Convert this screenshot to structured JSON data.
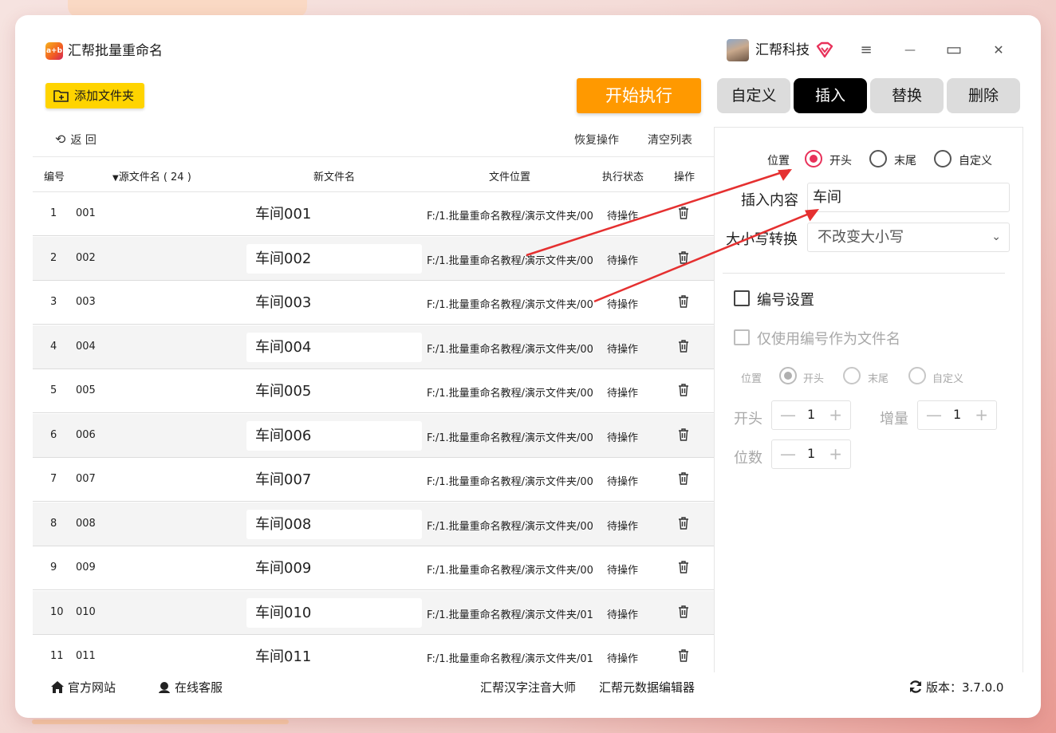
{
  "app": {
    "title": "汇帮批量重命名",
    "logo_text": "a+b"
  },
  "user": {
    "name": "汇帮科技"
  },
  "window_controls": {
    "menu": "≡",
    "minimize": "—",
    "maximize": "▭",
    "close": "✕"
  },
  "toolbar": {
    "add_folder": "添加文件夹",
    "start": "开始执行",
    "tabs": [
      {
        "label": "自定义",
        "active": false
      },
      {
        "label": "插入",
        "active": true
      },
      {
        "label": "替换",
        "active": false
      },
      {
        "label": "删除",
        "active": false
      }
    ]
  },
  "list_actions": {
    "back": "返 回",
    "restore": "恢复操作",
    "clear": "清空列表"
  },
  "table": {
    "headers": {
      "index": "编号",
      "source": "源文件名 ( 24 )",
      "new_name": "新文件名",
      "location": "文件位置",
      "status": "执行状态",
      "action": "操作"
    },
    "rows": [
      {
        "idx": "1",
        "src": "001",
        "new": "车间001",
        "path": "F:/1.批量重命名教程/演示文件夹/00",
        "status": "待操作"
      },
      {
        "idx": "2",
        "src": "002",
        "new": "车间002",
        "path": "F:/1.批量重命名教程/演示文件夹/00",
        "status": "待操作"
      },
      {
        "idx": "3",
        "src": "003",
        "new": "车间003",
        "path": "F:/1.批量重命名教程/演示文件夹/00",
        "status": "待操作"
      },
      {
        "idx": "4",
        "src": "004",
        "new": "车间004",
        "path": "F:/1.批量重命名教程/演示文件夹/00",
        "status": "待操作"
      },
      {
        "idx": "5",
        "src": "005",
        "new": "车间005",
        "path": "F:/1.批量重命名教程/演示文件夹/00",
        "status": "待操作"
      },
      {
        "idx": "6",
        "src": "006",
        "new": "车间006",
        "path": "F:/1.批量重命名教程/演示文件夹/00",
        "status": "待操作"
      },
      {
        "idx": "7",
        "src": "007",
        "new": "车间007",
        "path": "F:/1.批量重命名教程/演示文件夹/00",
        "status": "待操作"
      },
      {
        "idx": "8",
        "src": "008",
        "new": "车间008",
        "path": "F:/1.批量重命名教程/演示文件夹/00",
        "status": "待操作"
      },
      {
        "idx": "9",
        "src": "009",
        "new": "车间009",
        "path": "F:/1.批量重命名教程/演示文件夹/00",
        "status": "待操作"
      },
      {
        "idx": "10",
        "src": "010",
        "new": "车间010",
        "path": "F:/1.批量重命名教程/演示文件夹/01",
        "status": "待操作"
      },
      {
        "idx": "11",
        "src": "011",
        "new": "车间011",
        "path": "F:/1.批量重命名教程/演示文件夹/01",
        "status": "待操作"
      }
    ]
  },
  "panel": {
    "position_label": "位置",
    "position_options": [
      "开头",
      "末尾",
      "自定义"
    ],
    "position_selected": "开头",
    "insert_label": "插入内容",
    "insert_value": "车间",
    "case_label": "大小写转换",
    "case_value": "不改变大小写",
    "numbering_label": "编号设置",
    "numbering_only_label": "仅使用编号作为文件名",
    "num_position_label": "位置",
    "num_position_options": [
      "开头",
      "末尾",
      "自定义"
    ],
    "start_label": "开头",
    "start_value": "1",
    "increment_label": "增量",
    "increment_value": "1",
    "digits_label": "位数",
    "digits_value": "1",
    "minus": "—",
    "plus": "+"
  },
  "footer": {
    "website": "官方网站",
    "support": "在线客服",
    "link1": "汇帮汉字注音大师",
    "link2": "汇帮元数据编辑器",
    "version": "版本：3.7.0.0"
  },
  "colors": {
    "accent_orange": "#ff9900",
    "yellow": "#ffd400",
    "radio_red": "#e8315a",
    "arrow_red": "#e53030"
  }
}
